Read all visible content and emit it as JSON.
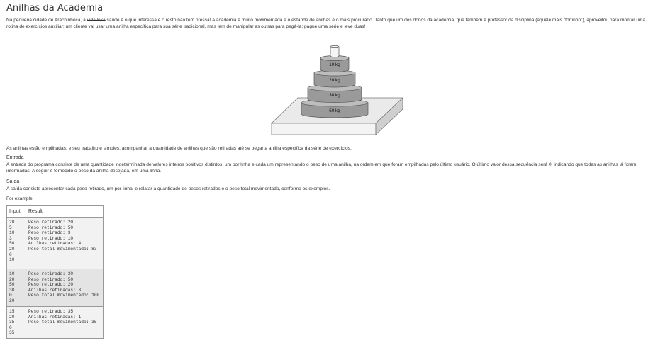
{
  "title": "Anilhas da Academia",
  "intro": {
    "before": "Na pequena cidade de Arachinhoca, a ",
    "struck": "vida loka",
    "after": " saúde é o que interessa e o resto não tem pressa! A academia é muito movimentada e o estande de anilhas é o mais procurado. Tanto que um dos donos da academia, que também é professor da disciplina (aquele mais \"fortinho\"), aproveitou para montar uma rotina de exercícios auxiliar: um cliente vai usar uma anilha específica para sua série tradicional, mas tem de manipular as outras para pegá-la: pague uma série e leve duas!"
  },
  "figure": {
    "weights": [
      "10 kg",
      "20 kg",
      "30 kg",
      "50 kg"
    ]
  },
  "lead": "As anilhas estão empilhadas, e seu trabalho é simples: acompanhar a quantidade de anilhas que são retiradas até se pegar a anilha específica da série de exercícios.",
  "input_section": {
    "heading": "Entrada",
    "text": "A entrada do programa consiste de uma quantidade indeterminada de valores inteiros positivos distintos, um por linha e cada um representando o peso de uma anilha, na ordem em que foram empilhadas pelo último usuário. O último valor dessa sequência será 0, indicando que todas as anilhas já foram informadas. A seguir é fornecido o peso da anilha desejada, em uma linha."
  },
  "output_section": {
    "heading": "Saída",
    "text": "A saída consiste apresentar cada peso retirado, um por linha, e relatar a quantidade de pesos retirados e o peso total movimentado, conforme os exemplos."
  },
  "example_label": "For example:",
  "table": {
    "headers": [
      "Input",
      "Result"
    ],
    "rows": [
      {
        "input": "20\n5\n10\n3\n50\n20\n0\n10",
        "result": "Peso retirado: 20\nPeso retirado: 50\nPeso retirado: 3\nPeso retirado: 10\nAnilhas retiradas: 4\nPeso total movimentado: 83"
      },
      {
        "input": "10\n20\n50\n30\n0\n20",
        "result": "Peso retirado: 30\nPeso retirado: 50\nPeso retirado: 20\nAnilhas retiradas: 3\nPeso total movimentado: 100"
      },
      {
        "input": "15\n20\n35\n0\n35",
        "result": "Peso retirado: 35\nAnilhas retiradas: 1\nPeso total movimentado: 35"
      }
    ]
  }
}
